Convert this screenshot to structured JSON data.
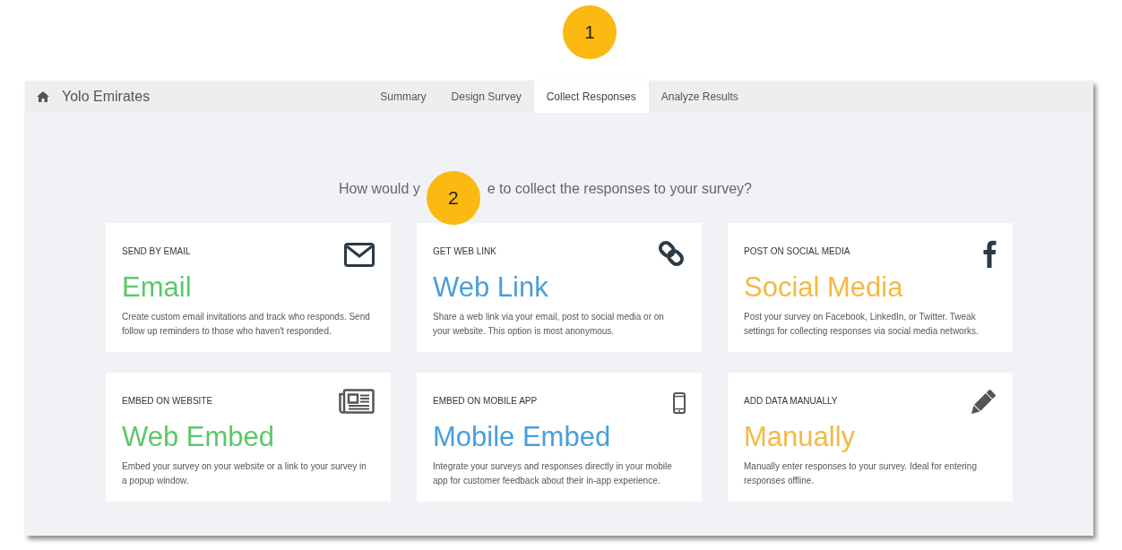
{
  "top_callout": {
    "label": "1"
  },
  "header": {
    "title": "Yolo Emirates"
  },
  "tabs": [
    {
      "label": "Summary",
      "selected": false
    },
    {
      "label": "Design Survey",
      "selected": false
    },
    {
      "label": "Collect Responses",
      "selected": true
    },
    {
      "label": "Analyze Results",
      "selected": false
    }
  ],
  "heading": {
    "text_before": "How would y",
    "callout": "2",
    "text_after": "e to collect the responses to your survey?"
  },
  "cards": [
    {
      "label": "SEND BY EMAIL",
      "title": "Email",
      "description": "Create custom email invitations and track who responds. Send follow up reminders to those who haven't responded.",
      "color": "#5bc86a"
    },
    {
      "label": "GET WEB LINK",
      "title": "Web Link",
      "description": "Share a web link via your email, post to social media or on your website. This option is most anonymous.",
      "color": "#4a9fd8"
    },
    {
      "label": "POST ON SOCIAL MEDIA",
      "title": "Social Media",
      "description": "Post your survey on Facebook, LinkedIn, or Twitter. Tweak settings for collecting responses via social media networks.",
      "color": "#f5b843"
    },
    {
      "label": "EMBED ON WEBSITE",
      "title": "Web Embed",
      "description": "Embed your survey on your website or a link to your survey in a popup window.",
      "color": "#5bc86a"
    },
    {
      "label": "EMBED ON MOBILE APP",
      "title": "Mobile Embed",
      "description": "Integrate your surveys and responses directly in your mobile app for customer feedback about their in-app experience.",
      "color": "#4a9fd8"
    },
    {
      "label": "ADD DATA MANUALLY",
      "title": "Manually",
      "description": "Manually enter responses to your survey. Ideal for entering responses offline.",
      "color": "#f5b843"
    }
  ]
}
